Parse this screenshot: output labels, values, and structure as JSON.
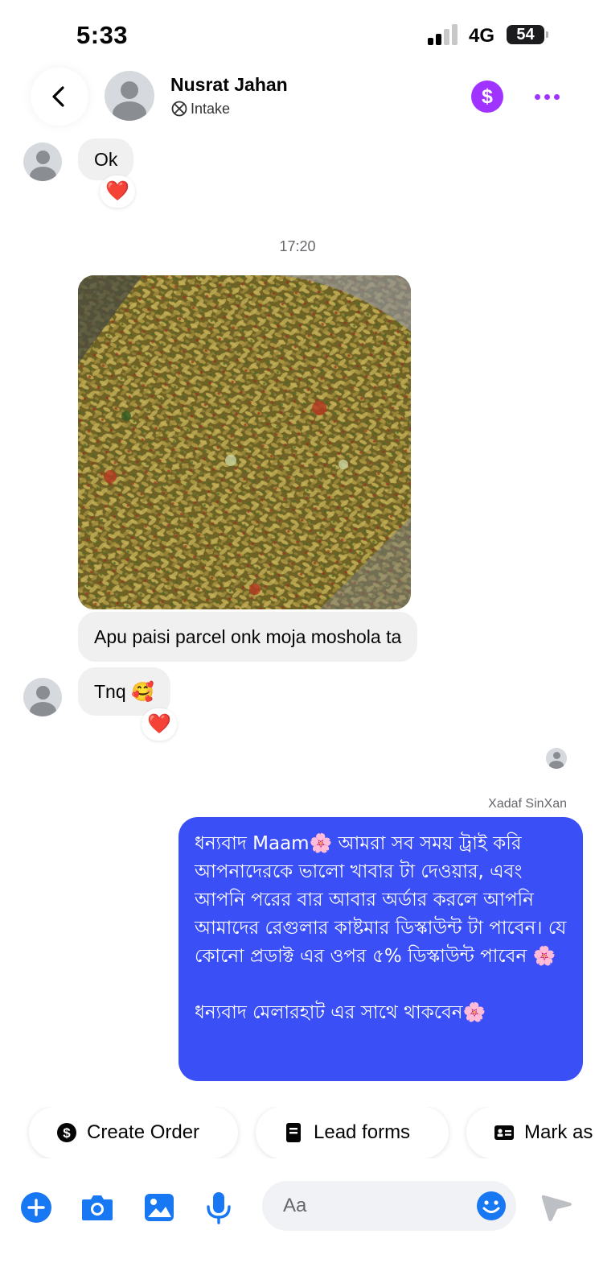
{
  "status_bar": {
    "time": "5:33",
    "network": "4G",
    "battery": "54"
  },
  "header": {
    "contact_name": "Nusrat Jahan",
    "contact_source": "Intake",
    "icons": [
      "back-arrow-icon",
      "dollar-icon",
      "more-icon"
    ]
  },
  "conversation": {
    "messages": [
      {
        "from": "contact",
        "text": "Ok",
        "reaction": "❤️"
      },
      {
        "timestamp": "17:20"
      },
      {
        "from": "contact",
        "type": "photo",
        "description_icon": "food-photo"
      },
      {
        "from": "contact",
        "text": "Apu paisi parcel onk moja moshola ta"
      },
      {
        "from": "contact",
        "text": "Tnq 🥰",
        "reaction": "❤️"
      },
      {
        "from": "me",
        "sender_name": "Xadaf SinXan",
        "text": "ধন্যবাদ Maam🌸 আমরা সব সময় ট্রাই করি আপনাদেরকে ভালো খাবার টা দেওয়ার, এবং আপনি পরের বার আবার অর্ডার করলে আপনি আমাদের রেগুলার কাষ্টমার ডিস্কাউন্ট টা পাবেন। যে কোনো প্রডাক্ট এর ওপর ৫% ডিস্কাউন্ট পাবেন 🌸\n\nধন্যবাদ মেলারহাট এর সাথে থাকবেন🌸"
      }
    ]
  },
  "quick_replies": [
    {
      "label": "Create Order",
      "icon": "dollar-circle-icon"
    },
    {
      "label": "Lead forms",
      "icon": "form-icon"
    },
    {
      "label": "Mark as",
      "icon": "id-card-icon"
    }
  ],
  "composer": {
    "placeholder": "Aa",
    "icons": [
      "plus-icon",
      "camera-icon",
      "gallery-icon",
      "microphone-icon",
      "emoji-icon",
      "send-icon"
    ]
  },
  "colors": {
    "accent_blue": "#3a4ff5",
    "purple": "#a033ff",
    "icon_blue": "#1877f2"
  }
}
